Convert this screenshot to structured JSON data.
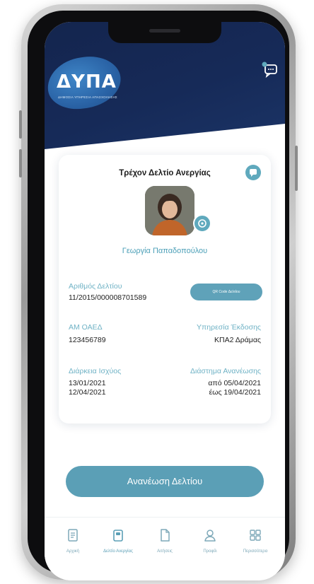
{
  "app": {
    "logo_text": "ΔΥΠΑ",
    "logo_subtitle": "ΔΗΜΟΣΙΑ ΥΠΗΡΕΣΙΑ ΑΠΑΣΧΟΛΗΣΗΣ"
  },
  "card": {
    "title": "Τρέχον Δελτίο Ανεργίας",
    "person_name": "Γεωργία Παπαδοπούλου",
    "card_number_label": "Αριθμός Δελτίου",
    "card_number_value": "11/2015/000008701589",
    "qr_button_label": "QR Code Δελτίου",
    "am_label": "AM ΟΑΕΔ",
    "am_value": "123456789",
    "issuer_label": "Υπηρεσία Έκδοσης",
    "issuer_value": "ΚΠΑ2 Δράμας",
    "validity_label": "Διάρκεια Ισχύος",
    "validity_from": "13/01/2021",
    "validity_to": "12/04/2021",
    "renewal_label": "Διάστημα Ανανέωσης",
    "renewal_from": "από 05/04/2021",
    "renewal_to": "έως 19/04/2021"
  },
  "actions": {
    "renew_label": "Ανανέωση Δελτίου"
  },
  "tabs": [
    {
      "label": "Αρχική",
      "icon": "document-icon"
    },
    {
      "label": "Δελτίο Ανεργίας",
      "icon": "card-icon",
      "active": true
    },
    {
      "label": "Αιτήσεις",
      "icon": "file-icon"
    },
    {
      "label": "Προφίλ",
      "icon": "user-icon"
    },
    {
      "label": "Περισσότερα",
      "icon": "grid-icon"
    }
  ],
  "colors": {
    "header_navy": "#14254e",
    "accent_teal": "#5b9fb6",
    "label_teal": "#6fb2c5"
  }
}
